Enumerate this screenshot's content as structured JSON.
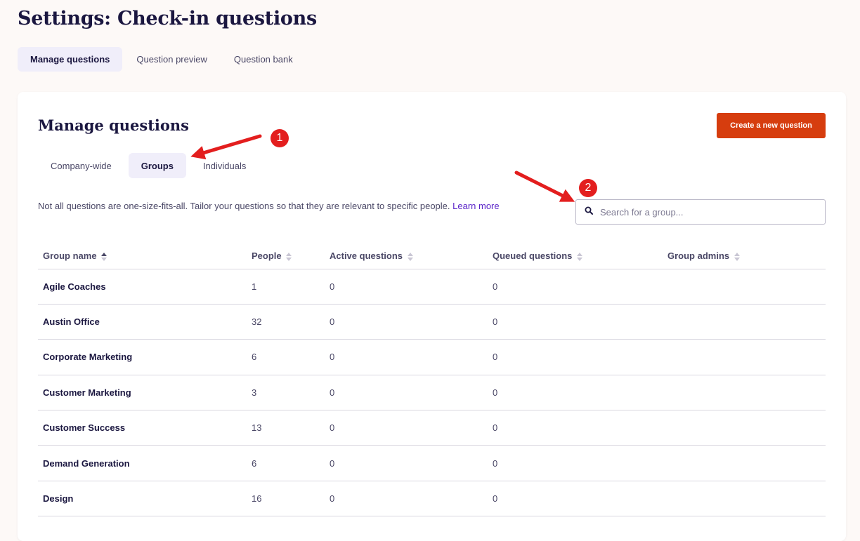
{
  "page": {
    "title": "Settings: Check-in questions"
  },
  "top_tabs": [
    {
      "label": "Manage questions",
      "active": true
    },
    {
      "label": "Question preview",
      "active": false
    },
    {
      "label": "Question bank",
      "active": false
    }
  ],
  "section": {
    "title": "Manage questions",
    "create_button": "Create a new question",
    "sub_tabs": [
      {
        "label": "Company-wide",
        "active": false
      },
      {
        "label": "Groups",
        "active": true
      },
      {
        "label": "Individuals",
        "active": false
      }
    ],
    "description": "Not all questions are one-size-fits-all. Tailor your questions so that they are relevant to specific people.",
    "learn_more": "Learn more",
    "search_placeholder": "Search for a group..."
  },
  "table": {
    "columns": [
      "Group name",
      "People",
      "Active questions",
      "Queued questions",
      "Group admins"
    ],
    "sorted_column": "Group name",
    "rows": [
      {
        "name": "Agile Coaches",
        "people": "1",
        "active": "0",
        "queued": "0",
        "admins": ""
      },
      {
        "name": "Austin Office",
        "people": "32",
        "active": "0",
        "queued": "0",
        "admins": ""
      },
      {
        "name": "Corporate Marketing",
        "people": "6",
        "active": "0",
        "queued": "0",
        "admins": ""
      },
      {
        "name": "Customer Marketing",
        "people": "3",
        "active": "0",
        "queued": "0",
        "admins": ""
      },
      {
        "name": "Customer Success",
        "people": "13",
        "active": "0",
        "queued": "0",
        "admins": ""
      },
      {
        "name": "Demand Generation",
        "people": "6",
        "active": "0",
        "queued": "0",
        "admins": ""
      },
      {
        "name": "Design",
        "people": "16",
        "active": "0",
        "queued": "0",
        "admins": ""
      }
    ]
  },
  "annotations": {
    "step1": "1",
    "step2": "2"
  },
  "colors": {
    "accent": "#d63d0e",
    "link": "#5a24c8",
    "annotation": "#e31e1e"
  }
}
